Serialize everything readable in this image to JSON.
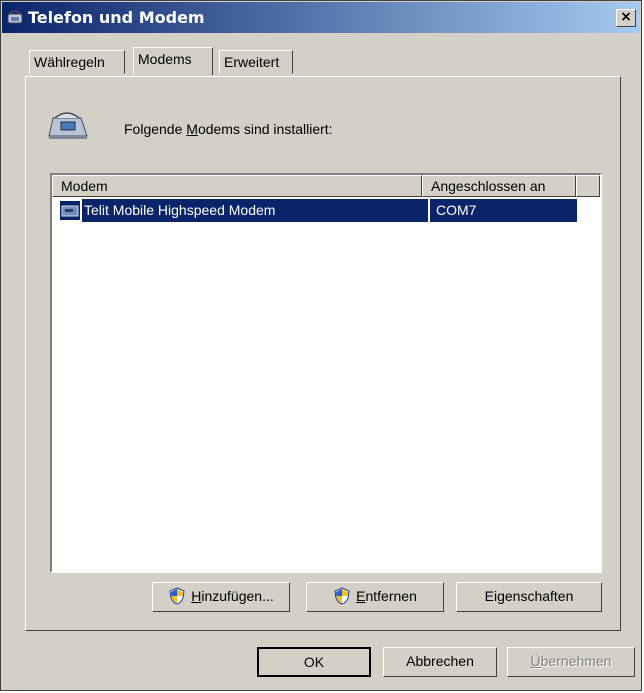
{
  "window": {
    "title": "Telefon und Modem",
    "close_label": "×"
  },
  "tabs": [
    {
      "label": "Wählregeln"
    },
    {
      "label": "Modems"
    },
    {
      "label": "Erweitert"
    }
  ],
  "modems": {
    "intro_before": "Folgende ",
    "intro_mnemonic": "M",
    "intro_after": "odems sind installiert:",
    "columns": [
      "Modem",
      "Angeschlossen an"
    ],
    "rows": [
      {
        "name": "Telit Mobile Highspeed Modem",
        "port": "COM7",
        "selected": true
      }
    ],
    "buttons": {
      "add": {
        "mnemonic": "H",
        "rest": "inzufügen..."
      },
      "remove": {
        "mnemonic": "E",
        "rest": "ntfernen"
      },
      "properties": {
        "before": "Ei",
        "mnemonic": "g",
        "after": "enschaften"
      }
    }
  },
  "dialog_buttons": {
    "ok": "OK",
    "cancel": "Abbrechen",
    "apply": {
      "mnemonic": "Ü",
      "rest": "bernehmen",
      "disabled": true
    }
  },
  "colors": {
    "accent": "#0a246a",
    "face": "#d4d0c8",
    "title_gradient_end": "#a6caf0"
  },
  "icons": [
    "telephone-modem-icon",
    "uac-shield-icon",
    "modem-device-icon",
    "close-icon"
  ]
}
